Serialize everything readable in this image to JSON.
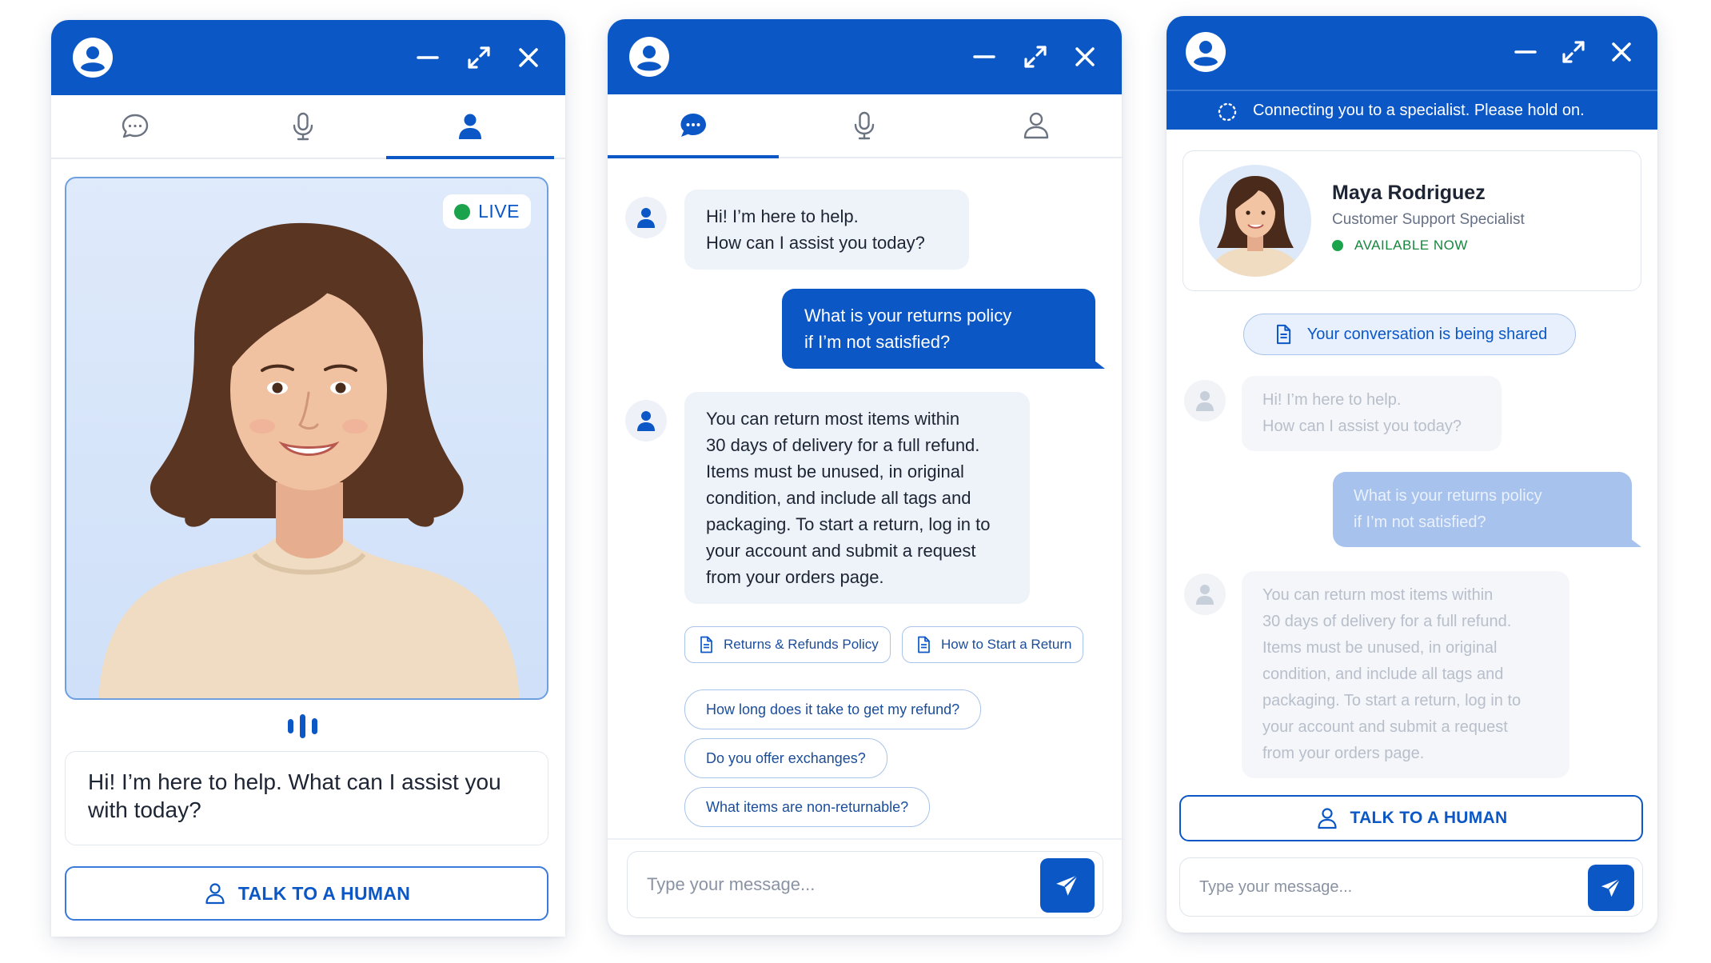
{
  "colors": {
    "primary": "#0c57c6",
    "live": "#1aa34a",
    "bubble_bot": "#eef2f9",
    "page_bg": "#ffffff"
  },
  "video_widget": {
    "live_label": "LIVE",
    "speech_text": "Hi! I’m here to help. What can I assist you with today?",
    "talk_to_human": "TALK TO A HUMAN",
    "active_tab": "avatar",
    "header_icons": [
      "user-circle-icon",
      "minimize-icon",
      "expand-icon",
      "close-icon"
    ],
    "tab_icons": [
      "chat-icon",
      "microphone-icon",
      "person-icon"
    ]
  },
  "chat_widget": {
    "active_tab": "chat",
    "messages": [
      {
        "role": "bot",
        "text": "Hi! I’m here to help.\nHow can I assist you today?"
      },
      {
        "role": "user",
        "text": "What is your returns policy\nif I’m not satisfied?"
      },
      {
        "role": "bot",
        "text": "You can return most items within\n30 days of delivery for a full refund.\nItems must be unused, in original\ncondition, and include all tags and\npackaging. To start a return, log in to\nyour account and submit a request\nfrom your orders page."
      }
    ],
    "doc_links": [
      "Returns & Refunds Policy",
      "How to Start a Return"
    ],
    "suggestions": [
      "How long does it take to get my refund?",
      "Do you offer exchanges?",
      "What items are non-returnable?"
    ],
    "composer_placeholder": "Type your message..."
  },
  "handoff_widget": {
    "status_text": "Connecting you to a specialist. Please hold on.",
    "agent": {
      "name": "Maya Rodriguez",
      "role": "Customer Support Specialist",
      "availability": "AVAILABLE NOW"
    },
    "share_notice": "Your conversation is being shared",
    "messages": [
      {
        "role": "bot",
        "text": "Hi! I’m here to help.\nHow can I assist you today?"
      },
      {
        "role": "user",
        "text": "What is your returns policy\nif I’m not satisfied?"
      },
      {
        "role": "bot",
        "text": "You can return most items within\n30 days of delivery for a full refund.\nItems must be unused, in original\ncondition, and include all tags and\npackaging. To start a return, log in to\nyour account and submit a request\nfrom your orders page."
      }
    ],
    "talk_to_human": "TALK TO A HUMAN",
    "composer_placeholder": "Type your message..."
  }
}
